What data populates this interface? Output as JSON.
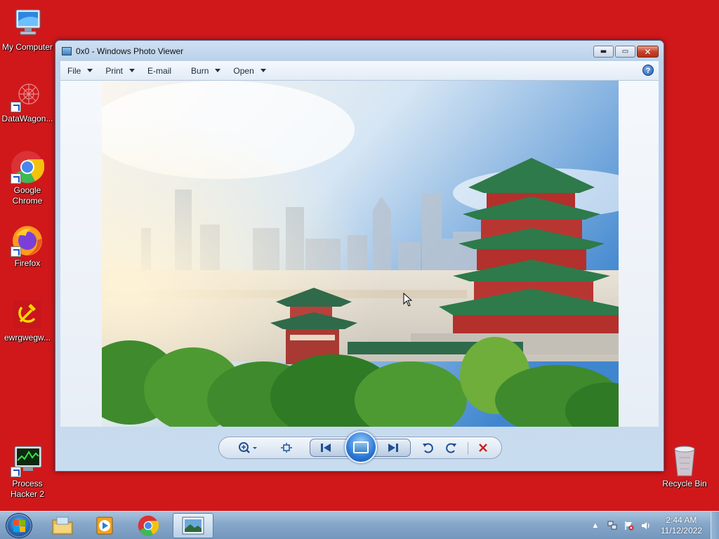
{
  "desktop": {
    "icons": [
      {
        "label": "My Computer",
        "icon": "computer-icon"
      },
      {
        "label": "DataWagon...",
        "icon": "datawagon-icon"
      },
      {
        "label": "Google Chrome",
        "icon": "chrome-icon"
      },
      {
        "label": "Firefox",
        "icon": "firefox-icon"
      },
      {
        "label": "ewrgwegw...",
        "icon": "hammer-sickle-icon"
      },
      {
        "label": "Process Hacker 2",
        "icon": "process-hacker-icon"
      },
      {
        "label": "Recycle Bin",
        "icon": "recycle-bin-icon"
      }
    ],
    "background_color": "#d0181b"
  },
  "window": {
    "title": "0x0 - Windows Photo Viewer",
    "buttons": {
      "minimize": "▬",
      "maximize": "▭",
      "close": "✕"
    },
    "menu": [
      {
        "label": "File",
        "has_dropdown": true
      },
      {
        "label": "Print",
        "has_dropdown": true
      },
      {
        "label": "E-mail",
        "has_dropdown": false
      },
      {
        "label": "Burn",
        "has_dropdown": true
      },
      {
        "label": "Open",
        "has_dropdown": true
      }
    ],
    "help": "?",
    "controls": {
      "zoom": "zoom-icon",
      "actual_size": "actual-size-icon",
      "previous": "previous-icon",
      "slideshow": "slideshow-icon",
      "next": "next-icon",
      "rotate_ccw": "rotate-counterclockwise-icon",
      "rotate_cw": "rotate-clockwise-icon",
      "delete": "delete-icon"
    }
  },
  "taskbar": {
    "items": [
      "explorer-icon",
      "media-player-icon",
      "chrome-icon",
      "photo-viewer-icon"
    ],
    "active_item": "photo-viewer-icon",
    "clock": {
      "time": "2:44 AM",
      "date": "11/12/2022"
    }
  }
}
